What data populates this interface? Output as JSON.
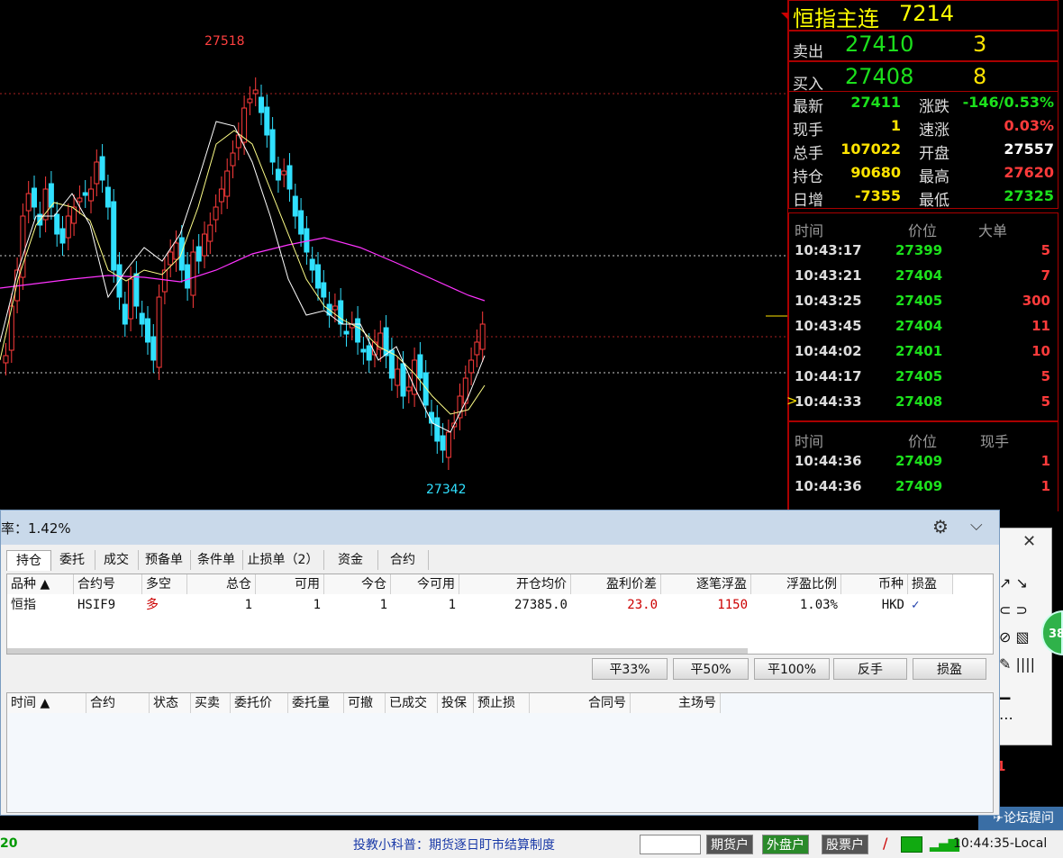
{
  "header": {
    "title": "恒指主连",
    "code": "7214"
  },
  "quote": {
    "sell_label": "卖出",
    "sell_price": "27410",
    "sell_qty": "3",
    "buy_label": "买入",
    "buy_price": "27408",
    "buy_qty": "8",
    "rows": [
      {
        "l1": "最新",
        "v1": "27411",
        "l2": "涨跌",
        "v2": "-146/0.53%"
      },
      {
        "l1": "现手",
        "v1": "1",
        "l2": "速涨",
        "v2": "0.03%"
      },
      {
        "l1": "总手",
        "v1": "107022",
        "l2": "开盘",
        "v2": "27557"
      },
      {
        "l1": "持仓",
        "v1": "90680",
        "l2": "最高",
        "v2": "27620"
      },
      {
        "l1": "日增",
        "v1": "-7355",
        "l2": "最低",
        "v2": "27325"
      }
    ]
  },
  "tape1": {
    "h_time": "时间",
    "h_price": "价位",
    "h_vol": "大单",
    "rows": [
      {
        "time": "10:43:17",
        "price": "27399",
        "vol": "5"
      },
      {
        "time": "10:43:21",
        "price": "27404",
        "vol": "7"
      },
      {
        "time": "10:43:25",
        "price": "27405",
        "vol": "300"
      },
      {
        "time": "10:43:45",
        "price": "27404",
        "vol": "11"
      },
      {
        "time": "10:44:02",
        "price": "27401",
        "vol": "10"
      },
      {
        "time": "10:44:17",
        "price": "27405",
        "vol": "5"
      },
      {
        "time": "10:44:33",
        "price": "27408",
        "vol": "5"
      }
    ]
  },
  "tape2": {
    "h_time": "时间",
    "h_price": "价位",
    "h_vol": "现手",
    "rows": [
      {
        "time": "10:44:36",
        "price": "27409",
        "vol": "1"
      },
      {
        "time": "10:44:36",
        "price": "27409",
        "vol": "1"
      }
    ]
  },
  "chart": {
    "high_label": "27518",
    "low_label": "27342"
  },
  "dialog": {
    "title": "率：1.42%",
    "tabs": [
      "持仓",
      "委托",
      "成交",
      "预备单",
      "条件单",
      "止损单（2）",
      "资金",
      "合约"
    ],
    "pos_headers": [
      "品种 ▲",
      "合约号",
      "多空",
      "总仓",
      "可用",
      "今仓",
      "今可用",
      "开仓均价",
      "盈利价差",
      "逐笔浮盈",
      "浮盈比例",
      "币种",
      "损盈"
    ],
    "pos_row": [
      "恒指",
      "HSIF9",
      "多",
      "1",
      "1",
      "1",
      "1",
      "27385.0",
      "23.0",
      "1150",
      "1.03%",
      "HKD",
      "✓"
    ],
    "buttons": [
      "平33%",
      "平50%",
      "平100%",
      "反手",
      "损盈"
    ],
    "order_headers": [
      "时间 ▲",
      "合约",
      "状态",
      "买卖",
      "委托价",
      "委托量",
      "可撤",
      "已成交",
      "投保",
      "预止损",
      "合同号",
      "主场号"
    ]
  },
  "side_widget": {
    "badge": "38",
    "forum": "论坛提问"
  },
  "status": {
    "left": "20",
    "ticker": "投教小科普：期货逐日盯市结算制度",
    "btn_futures": "期货户",
    "btn_foreign": "外盘户",
    "btn_stock": "股票户",
    "clock": "10:44:35-Local"
  },
  "colors": {
    "up": "#ff3b3b",
    "down": "#30e0ff",
    "ma5": "#ffffff",
    "ma10": "#ffff66",
    "ma60": "#ff33ff",
    "border": "#aa0000"
  }
}
